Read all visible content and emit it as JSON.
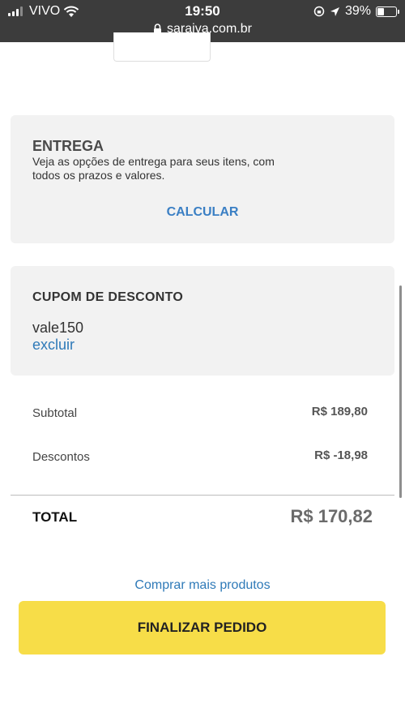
{
  "status_bar": {
    "carrier": "VIVO",
    "time": "19:50",
    "battery_percent": "39%",
    "battery_level": 0.39,
    "url": "saraiva.com.br"
  },
  "delivery": {
    "title": "ENTREGA",
    "description": "Veja as opções de entrega para seus itens, com todos os prazos e valores.",
    "calculate_label": "CALCULAR"
  },
  "coupon": {
    "title": "CUPOM DE DESCONTO",
    "code": "vale150",
    "remove_label": "excluir"
  },
  "summary": {
    "subtotal_label": "Subtotal",
    "subtotal_value": "R$ 189,80",
    "discounts_label": "Descontos",
    "discounts_value": "R$ -18,98",
    "total_label": "TOTAL",
    "total_value": "R$ 170,82"
  },
  "actions": {
    "more_products_label": "Comprar mais produtos",
    "finalize_label": "FINALIZAR PEDIDO"
  },
  "colors": {
    "accent_link": "#2f7ab8",
    "finalize_button": "#f7dd48",
    "card_background": "#f2f2f2"
  }
}
